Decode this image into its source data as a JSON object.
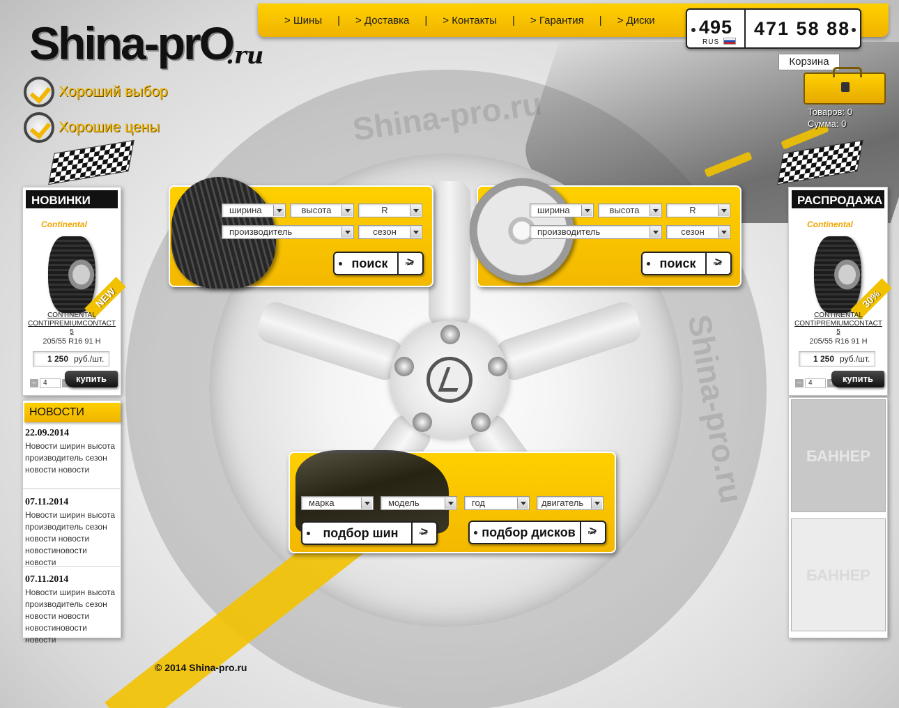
{
  "logo": {
    "main": "Shina-prO",
    "domain": ".ru"
  },
  "slogans": [
    "Хороший выбор",
    "Хорошие цены"
  ],
  "nav": [
    "> Шины",
    "> Доставка",
    "> Контакты",
    "> Гарантия",
    "> Диски"
  ],
  "nav_separator": "|",
  "phone": {
    "code": "495",
    "number": "471 58 88",
    "country": "RUS"
  },
  "cart": {
    "label": "Корзина",
    "items": "Товаров: 0",
    "sum": "Сумма: 0"
  },
  "watermarks": [
    "Shina-pro.ru",
    "Shina-pro.ru"
  ],
  "new_products": {
    "title": "НОВИНКИ",
    "brand": "Continental",
    "badge": "NEW",
    "name": "CONTINENTAL CONTIPREMIUMCONTACT 5",
    "size": "205/55 R16 91 H",
    "price": "1 250",
    "price_unit": "руб./шт.",
    "qty": "4",
    "buy": "купить"
  },
  "sale": {
    "title": "РАСПРОДАЖА",
    "brand": "Continental",
    "badge": "30%",
    "name": "CONTINENTAL CONTIPREMIUMCONTACT 5",
    "size": "205/55 R16 91 H",
    "price": "1 250",
    "price_unit": "руб./шт.",
    "qty": "4",
    "buy": "купить"
  },
  "news": {
    "title": "НОВОСТИ",
    "items": [
      {
        "date": "22.09.2014",
        "text": "Новости ширин высота производитель сезон новости новости"
      },
      {
        "date": "07.11.2014",
        "text": "Новости ширин высота производитель сезон новости новости новостиновости новости"
      },
      {
        "date": "07.11.2014",
        "text": "Новости ширин высота производитель сезон новости новости новостиновости новости"
      }
    ]
  },
  "banners": [
    "БАННЕР",
    "БАННЕР"
  ],
  "tyre_search": {
    "width": "ширина",
    "height": "высота",
    "radius": "R",
    "maker": "производитель",
    "season": "сезон",
    "button": "поиск",
    "arrow": ">",
    "mini": "RUS"
  },
  "rim_search": {
    "width": "ширина",
    "height": "высота",
    "radius": "R",
    "maker": "производитель",
    "season": "сезон",
    "button": "поиск",
    "arrow": ">",
    "mini": "RUS"
  },
  "car_search": {
    "make": "марка",
    "model": "модель",
    "year": "год",
    "engine": "двигатель",
    "tyres_button": "подбор шин",
    "rims_button": "подбор дисков",
    "arrow": ">",
    "mini": "RUS"
  },
  "footer": "© 2014 Shina-pro.ru",
  "colors": {
    "accent": "#f2c200",
    "dark": "#111111"
  }
}
